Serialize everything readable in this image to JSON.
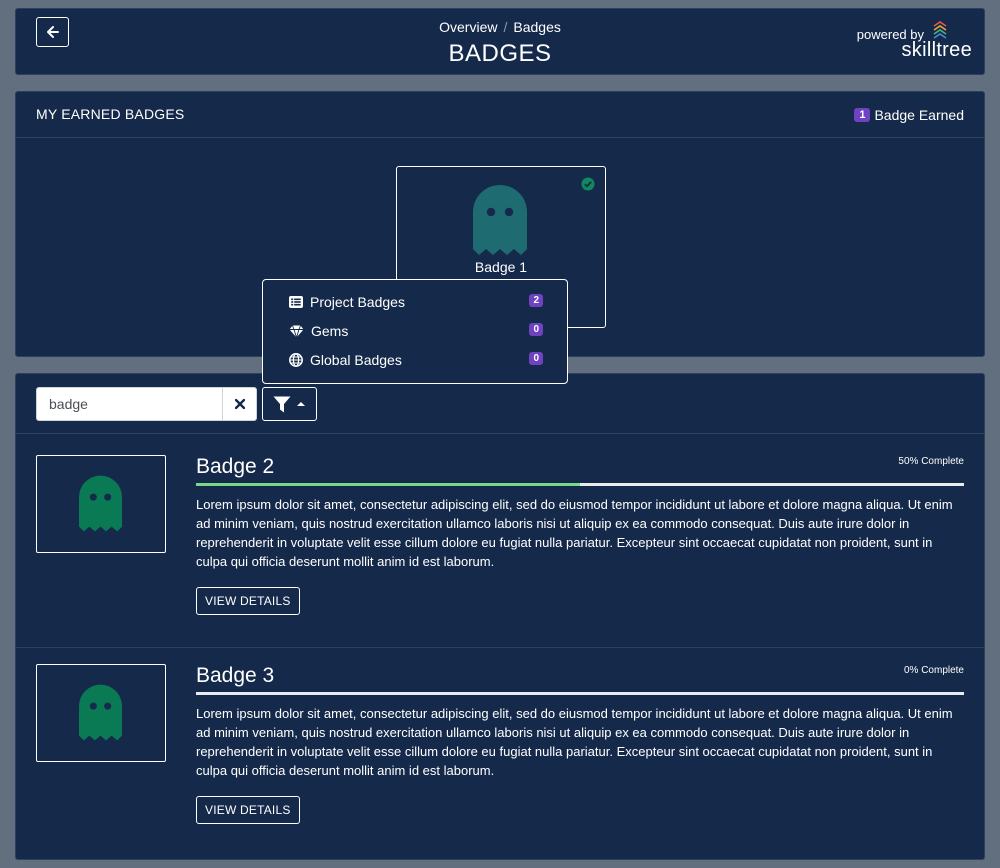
{
  "header": {
    "breadcrumb": [
      "Overview",
      "Badges"
    ],
    "breadcrumb_separator": "/",
    "title": "BADGES",
    "powered_by": "powered by",
    "logo_text": "skilltree",
    "back_icon": "arrow-left-icon"
  },
  "earned": {
    "title": "MY EARNED BADGES",
    "count": "1",
    "count_label": "Badge Earned",
    "badges": [
      {
        "name": "Badge 1",
        "icon": "ghost-icon",
        "status_icon": "check-circle-icon"
      }
    ]
  },
  "filter_menu": {
    "items": [
      {
        "label": "Project Badges",
        "count": "2",
        "icon": "list-icon"
      },
      {
        "label": "Gems",
        "count": "0",
        "icon": "gem-icon"
      },
      {
        "label": "Global Badges",
        "count": "0",
        "icon": "globe-icon"
      }
    ]
  },
  "search": {
    "value": "badge",
    "clear_icon": "times-icon",
    "filter_icon": "filter-icon"
  },
  "badges": [
    {
      "name": "Badge 2",
      "percent_label": "50% Complete",
      "progress": 0.5,
      "description": "Lorem ipsum dolor sit amet, consectetur adipiscing elit, sed do eiusmod tempor incididunt ut labore et dolore magna aliqua. Ut enim ad minim veniam, quis nostrud exercitation ullamco laboris nisi ut aliquip ex ea commodo consequat. Duis aute irure dolor in reprehenderit in voluptate velit esse cillum dolore eu fugiat nulla pariatur. Excepteur sint occaecat cupidatat non proident, sunt in culpa qui officia deserunt mollit anim id est laborum.",
      "button_label": "VIEW DETAILS"
    },
    {
      "name": "Badge 3",
      "percent_label": "0% Complete",
      "progress": 0,
      "description": "Lorem ipsum dolor sit amet, consectetur adipiscing elit, sed do eiusmod tempor incididunt ut labore et dolore magna aliqua. Ut enim ad minim veniam, quis nostrud exercitation ullamco laboris nisi ut aliquip ex ea commodo consequat. Duis aute irure dolor in reprehenderit in voluptate velit esse cillum dolore eu fugiat nulla pariatur. Excepteur sint occaecat cupidatat non proident, sunt in culpa qui officia deserunt mollit anim id est laborum.",
      "button_label": "VIEW DETAILS"
    }
  ],
  "colors": {
    "background": "#626f7f",
    "card": "#152a4a",
    "accent_purple": "#6f42c1",
    "progress_green": "#7ed68b",
    "ghost_earned": "#1f6b72",
    "ghost_unearned": "#0a7a55",
    "check_green": "#0f8a5f"
  }
}
